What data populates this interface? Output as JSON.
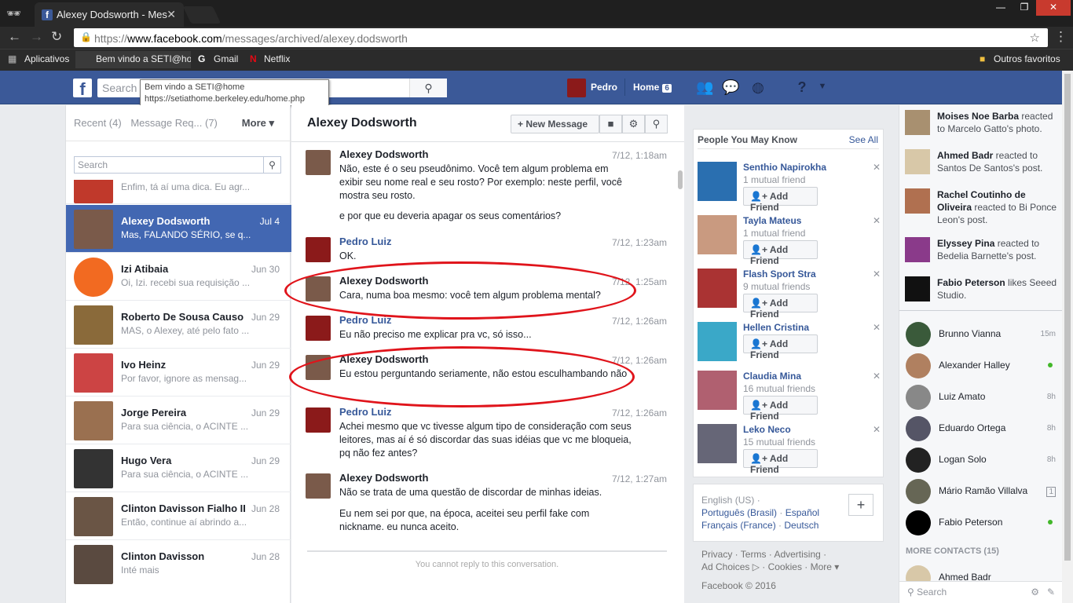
{
  "browser": {
    "tab_title": "Alexey Dodsworth - Mes",
    "url_scheme": "https://",
    "url_domain": "www.facebook.com",
    "url_path": "/messages/archived/alexey.dodsworth",
    "bookmarks": [
      "Aplicativos",
      "Bem vindo a SETI@ho",
      "Gmail",
      "Netflix"
    ],
    "other_bookmarks": "Outros favoritos",
    "tooltip_title": "Bem vindo a SETI@home",
    "tooltip_url": "https://setiathome.berkeley.edu/home.php"
  },
  "header": {
    "search_placeholder": "Search",
    "user": "Pedro",
    "home": "Home",
    "home_badge": "6"
  },
  "inbox": {
    "recent": "Recent (4)",
    "requests": "Message Req... (7)",
    "more": "More ▾",
    "search_placeholder": "Search",
    "threads": [
      {
        "name": "",
        "date": "",
        "snippet": "Enfim, tá aí uma dica. Eu agr...",
        "color": "#c0392b"
      },
      {
        "name": "Alexey Dodsworth",
        "date": "Jul 4",
        "snippet": "Mas, FALANDO SÉRIO, se q...",
        "color": "#7a5a4a"
      },
      {
        "name": "Izi Atibaia",
        "date": "Jun 30",
        "snippet": "Oi, Izi. recebi sua requisição ...",
        "color": "#f26a21"
      },
      {
        "name": "Roberto De Sousa Causo",
        "date": "Jun 29",
        "snippet": "MAS, o Alexey, até pelo fato ...",
        "color": "#8a6a3a"
      },
      {
        "name": "Ivo Heinz",
        "date": "Jun 29",
        "snippet": "Por favor, ignore as mensag...",
        "color": "#c44"
      },
      {
        "name": "Jorge Pereira",
        "date": "Jun 29",
        "snippet": "Para sua ciência, o ACINTE ...",
        "color": "#9a7050"
      },
      {
        "name": "Hugo Vera",
        "date": "Jun 29",
        "snippet": "Para sua ciência, o ACINTE ...",
        "color": "#333"
      },
      {
        "name": "Clinton Davisson Fialho II",
        "date": "Jun 28",
        "snippet": "Então, continue aí abrindo a...",
        "color": "#6a5545"
      },
      {
        "name": "Clinton Davisson",
        "date": "Jun 28",
        "snippet": "Inté mais",
        "color": "#5a4a40"
      }
    ]
  },
  "conversation": {
    "title": "Alexey Dodsworth",
    "new_message": "New Message",
    "messages": [
      {
        "sender": "Alexey Dodsworth",
        "time": "7/12, 1:18am",
        "text": "Não, este é o seu pseudônimo. Você tem algum problema em exibir seu nome real e seu rosto? Por exemplo: neste perfil, você mostra seu rosto.",
        "text2": "e por que eu deveria apagar os seus comentários?"
      },
      {
        "sender": "Pedro Luiz",
        "time": "7/12, 1:23am",
        "text": "OK."
      },
      {
        "sender": "Alexey Dodsworth",
        "time": "7/12, 1:25am",
        "text": "Cara, numa boa mesmo: você tem algum problema mental?"
      },
      {
        "sender": "Pedro Luiz",
        "time": "7/12, 1:26am",
        "text": "Eu não preciso me explicar pra vc, só isso..."
      },
      {
        "sender": "Alexey Dodsworth",
        "time": "7/12, 1:26am",
        "text": "Eu estou perguntando seriamente, não estou esculhambando não"
      },
      {
        "sender": "Pedro Luiz",
        "time": "7/12, 1:26am",
        "text": "Achei mesmo que vc tivesse algum tipo de consideração com seus leitores, mas aí é só discordar das suas idéias que vc me bloqueia, pq não fez antes?"
      },
      {
        "sender": "Alexey Dodsworth",
        "time": "7/12, 1:27am",
        "text": "Não se trata de uma questão de discordar de minhas ideias.",
        "text2": "Eu nem sei por que, na época, aceitei seu perfil fake com nickname. eu nunca aceito."
      }
    ],
    "cannot_reply": "You cannot reply to this conversation."
  },
  "pymk": {
    "title": "People You May Know",
    "see_all": "See All",
    "add_friend": "Add Friend",
    "people": [
      {
        "name": "Senthio Napirokha",
        "mutual": "1 mutual friend",
        "color": "#2a6fb0"
      },
      {
        "name": "Tayla Mateus",
        "mutual": "1 mutual friend",
        "color": "#c99a80"
      },
      {
        "name": "Flash Sport Stra",
        "mutual": "9 mutual friends",
        "color": "#a33"
      },
      {
        "name": "Hellen Cristina",
        "mutual": "",
        "color": "#3aa8c8"
      },
      {
        "name": "Claudia Mina",
        "mutual": "16 mutual friends",
        "color": "#b06070"
      },
      {
        "name": "Leko Neco",
        "mutual": "15 mutual friends",
        "color": "#667"
      }
    ]
  },
  "languages": {
    "current": "English (US) ·",
    "l1": "Português (Brasil)",
    "l2": "Español",
    "l3": "Français (France)",
    "l4": "Deutsch"
  },
  "footer": {
    "line1": "Privacy · Terms · Advertising ·",
    "line2": "Ad Choices ▷ · Cookies · More ▾",
    "copyright": "Facebook © 2016"
  },
  "ticker": [
    {
      "bold1": "Moises Noe Barba",
      "rest": " reacted to Marcelo Gatto's photo.",
      "color": "#a89070"
    },
    {
      "bold1": "Ahmed Badr",
      "rest": " reacted to Santos De Santos's post.",
      "color": "#d8c8a8"
    },
    {
      "bold1": "Rachel Coutinho de Oliveira",
      "rest": " reacted to Bi Ponce Leon's post.",
      "color": "#b07050"
    },
    {
      "bold1": "Elyssey Pina",
      "rest": " reacted to Bedelia Barnette's post.",
      "color": "#8a3a8a"
    },
    {
      "bold1": "Fabio Peterson",
      "rest": " likes Seeed Studio.",
      "color": "#111"
    }
  ],
  "chat": {
    "contacts": [
      {
        "name": "Brunno Vianna",
        "status": "15m",
        "online": false,
        "color": "#3a5a3a"
      },
      {
        "name": "Alexander Halley",
        "status": "",
        "online": true,
        "color": "#b08060"
      },
      {
        "name": "Luiz Amato",
        "status": "8h",
        "online": false,
        "color": "#888"
      },
      {
        "name": "Eduardo Ortega",
        "status": "8h",
        "online": false,
        "color": "#556"
      },
      {
        "name": "Logan Solo",
        "status": "8h",
        "online": false,
        "color": "#222"
      },
      {
        "name": "Mário Ramão Villalva",
        "status": "1",
        "online": false,
        "color": "#665"
      },
      {
        "name": "Fabio Peterson",
        "status": "",
        "online": true,
        "color": "#000"
      }
    ],
    "more_contacts": "MORE CONTACTS (15)",
    "partial": "Ahmed Badr",
    "search_placeholder": "Search"
  }
}
